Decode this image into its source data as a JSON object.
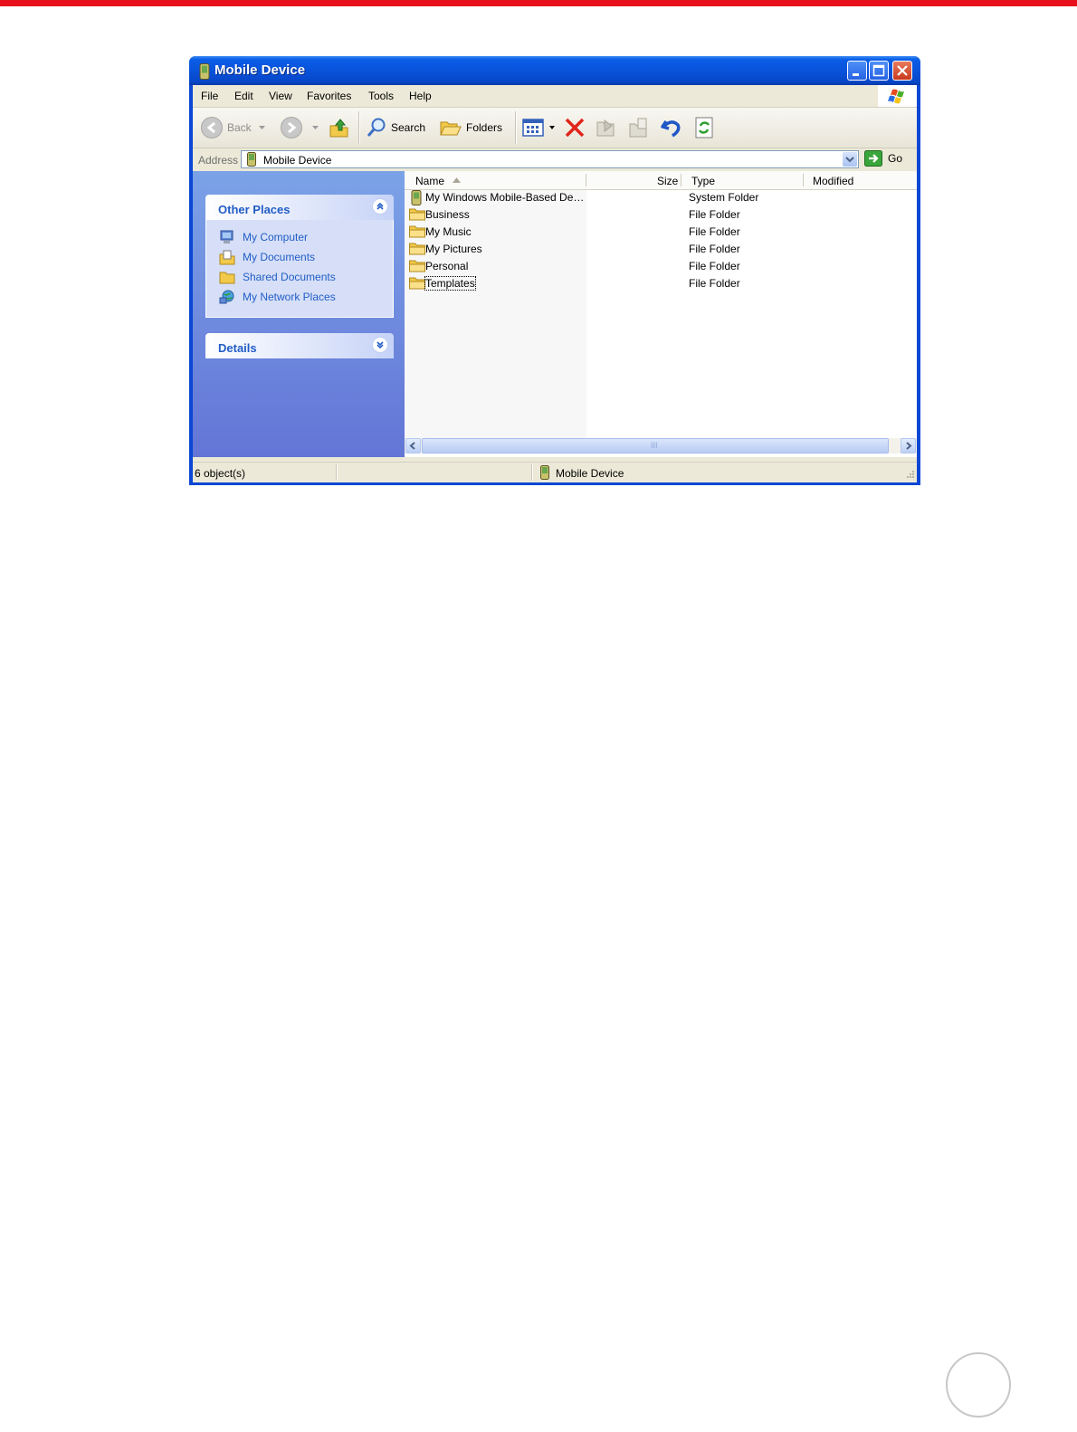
{
  "window": {
    "title": "Mobile Device",
    "title_icon": "mobile-device-icon"
  },
  "menu": [
    "File",
    "Edit",
    "View",
    "Favorites",
    "Tools",
    "Help"
  ],
  "toolbar": {
    "back_label": "Back",
    "search_label": "Search",
    "folders_label": "Folders"
  },
  "address": {
    "label": "Address",
    "value": "Mobile Device",
    "go_label": "Go"
  },
  "taskpane": {
    "other_places": {
      "title": "Other Places",
      "items": [
        {
          "label": "My Computer",
          "icon": "my-computer-icon"
        },
        {
          "label": "My Documents",
          "icon": "my-documents-icon"
        },
        {
          "label": "Shared Documents",
          "icon": "shared-documents-icon"
        },
        {
          "label": "My Network Places",
          "icon": "network-places-icon"
        }
      ]
    },
    "details": {
      "title": "Details"
    }
  },
  "filelist": {
    "columns": [
      "Name",
      "Size",
      "Type",
      "Modified"
    ],
    "rows": [
      {
        "name": "My Windows Mobile-Based De…",
        "type": "System Folder",
        "icon": "mobile-device-icon"
      },
      {
        "name": "Business",
        "type": "File Folder",
        "icon": "folder-icon"
      },
      {
        "name": "My Music",
        "type": "File Folder",
        "icon": "folder-icon"
      },
      {
        "name": "My Pictures",
        "type": "File Folder",
        "icon": "folder-icon"
      },
      {
        "name": "Personal",
        "type": "File Folder",
        "icon": "folder-icon"
      },
      {
        "name": "Templates",
        "type": "File Folder",
        "icon": "folder-icon"
      }
    ],
    "scroll_grip": "III"
  },
  "status": {
    "objects": "6 object(s)",
    "location": "Mobile Device"
  },
  "colors": {
    "page_top_bar": "#e8101a",
    "titlebar": "#0a5de6",
    "taskpane_top": "#7ba2e7",
    "taskpane_bottom": "#6375d6",
    "link": "#215dc6"
  }
}
